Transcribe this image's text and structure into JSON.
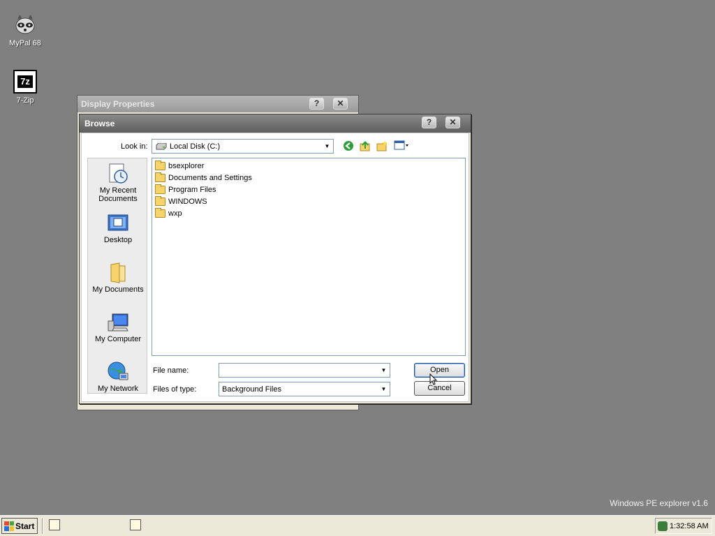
{
  "desktop": {
    "icons": [
      {
        "label": "MyPal 68",
        "icon": "raccoon-icon"
      },
      {
        "label": "7-Zip",
        "icon": "7zip-icon",
        "glyph": "7z"
      }
    ],
    "watermark": "Windows PE explorer v1.6"
  },
  "background_window": {
    "title": "Display Properties",
    "help_label": "?",
    "close_label": "✕"
  },
  "browse_dialog": {
    "title": "Browse",
    "help_label": "?",
    "close_label": "✕",
    "look_in_label": "Look in:",
    "look_in_value": "Local Disk (C:)",
    "places": [
      {
        "label": "My Recent Documents",
        "icon": "recent-documents-icon"
      },
      {
        "label": "Desktop",
        "icon": "desktop-icon"
      },
      {
        "label": "My Documents",
        "icon": "my-documents-icon"
      },
      {
        "label": "My Computer",
        "icon": "my-computer-icon"
      },
      {
        "label": "My Network",
        "icon": "my-network-icon"
      }
    ],
    "files": [
      "bsexplorer",
      "Documents and Settings",
      "Program Files",
      "WINDOWS",
      "wxp"
    ],
    "file_name_label": "File name:",
    "file_name_value": "",
    "files_of_type_label": "Files of type:",
    "files_of_type_value": "Background Files",
    "open_label": "Open",
    "cancel_label": "Cancel"
  },
  "taskbar": {
    "start_label": "Start",
    "clock": "1:32:58 AM"
  }
}
